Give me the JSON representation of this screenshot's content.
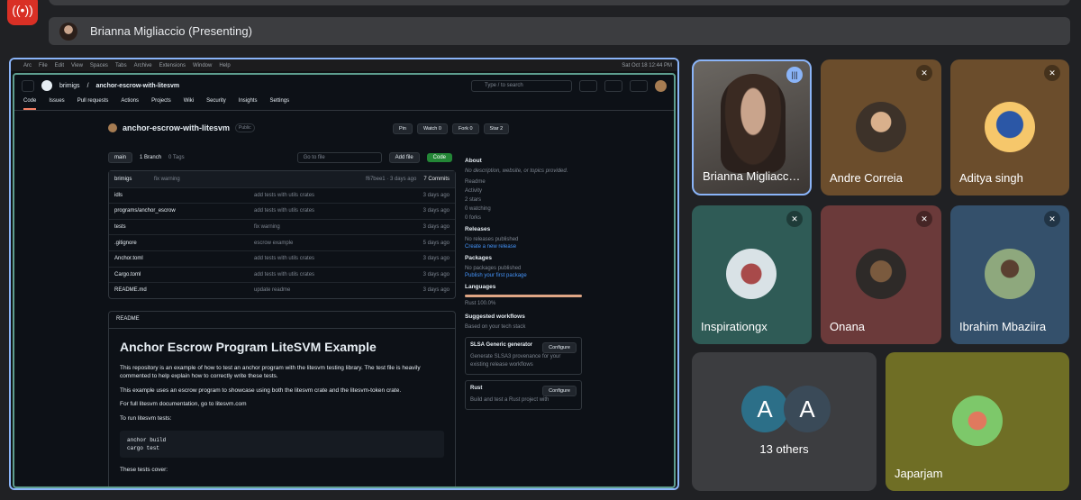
{
  "presenter": {
    "name": "Brianna Migliaccio (Presenting)"
  },
  "mac_menu": [
    "Arc",
    "File",
    "Edit",
    "View",
    "Spaces",
    "Tabs",
    "Archive",
    "Extensions",
    "Window",
    "Help"
  ],
  "mac_clock": "Sat Oct 18  12:44 PM",
  "github": {
    "owner": "brimigs",
    "repo": "anchor-escrow-with-litesvm",
    "search_placeholder": "Type / to search",
    "tabs": [
      "Code",
      "Issues",
      "Pull requests",
      "Actions",
      "Projects",
      "Wiki",
      "Security",
      "Insights",
      "Settings"
    ],
    "visibility": "Public",
    "pin": "Pin",
    "watch": "Watch  0",
    "fork": "Fork  0",
    "star": "Star  2",
    "branch": "main",
    "branches": "1 Branch",
    "tags": "0 Tags",
    "goto": "Go to file",
    "add_file": "Add file",
    "code_btn": "Code",
    "last_commit_user": "brimigs",
    "last_commit_msg": "fix warning",
    "last_commit_meta": "f67bee1 · 3 days ago",
    "commits": "7 Commits",
    "files": [
      {
        "name": "idls",
        "msg": "add tests with utils crates",
        "date": "3 days ago"
      },
      {
        "name": "programs/anchor_escrow",
        "msg": "add tests with utils crates",
        "date": "3 days ago"
      },
      {
        "name": "tests",
        "msg": "fix warning",
        "date": "3 days ago"
      },
      {
        "name": ".gitignore",
        "msg": "escrow example",
        "date": "5 days ago"
      },
      {
        "name": "Anchor.toml",
        "msg": "add tests with utils crates",
        "date": "3 days ago"
      },
      {
        "name": "Cargo.toml",
        "msg": "add tests with utils crates",
        "date": "3 days ago"
      },
      {
        "name": "README.md",
        "msg": "update readme",
        "date": "3 days ago"
      }
    ],
    "readme_label": "README",
    "readme_title": "Anchor Escrow Program LiteSVM Example",
    "readme_p1": "This repository is an example of how to test an anchor program with the litesvm testing library. The test file is heavily commented to help explain how to correctly write these tests.",
    "readme_p2": "This example uses an escrow program to showcase using both the litesvm crate and the litesvm-token crate.",
    "readme_p3": "For full litesvm documentation, go to litesvm.com",
    "readme_p4": "To run litesvm tests:",
    "readme_code1": "anchor build",
    "readme_code2": "cargo test",
    "readme_p5": "These tests cover:",
    "about": {
      "title": "About",
      "desc": "No description, website, or topics provided.",
      "items": [
        "Readme",
        "Activity",
        "2 stars",
        "0 watching",
        "0 forks"
      ],
      "releases": "Releases",
      "releases_none": "No releases published",
      "releases_link": "Create a new release",
      "packages": "Packages",
      "packages_none": "No packages published",
      "packages_link": "Publish your first package",
      "languages": "Languages",
      "lang": "Rust 100.0%",
      "workflows": "Suggested workflows",
      "workflows_sub": "Based on your tech stack",
      "wf1_title": "SLSA Generic generator",
      "wf1_desc": "Generate SLSA3 provenance for your existing release workflows",
      "wf2_title": "Rust",
      "wf2_desc": "Build and test a Rust project with",
      "configure": "Configure"
    }
  },
  "participants": [
    {
      "name": "Brianna Migliacc…"
    },
    {
      "name": "Andre Correia"
    },
    {
      "name": "Aditya singh"
    },
    {
      "name": "Inspirationgx"
    },
    {
      "name": "Onana"
    },
    {
      "name": "Ibrahim Mbaziira"
    },
    {
      "name": "13 others",
      "initials": [
        "A",
        "A"
      ]
    },
    {
      "name": "Japarjam"
    }
  ],
  "colors": {
    "accent": "#8ab4f8",
    "live": "#d93025",
    "github_green": "#238636"
  }
}
